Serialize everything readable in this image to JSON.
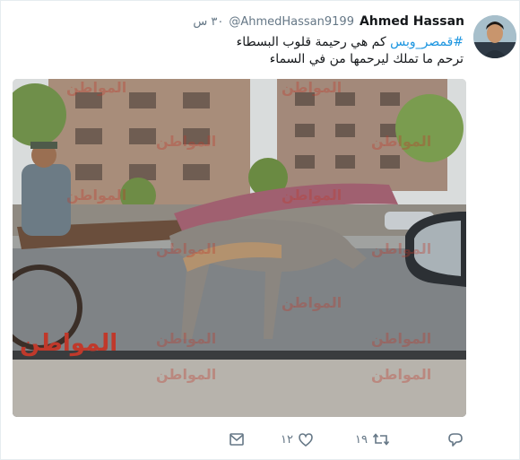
{
  "tweet": {
    "author_name": "Ahmed Hassan",
    "author_handle": "@AhmedHassan9199",
    "timestamp": "٣٠ س",
    "hashtag": "#قمصر_وبس",
    "text_line1": " كم هي رحيمة قلوب البسطاء",
    "text_line2": "ترحم ما تملك ليرحمها من في السماء"
  },
  "photo": {
    "watermark": "المواطن",
    "logo_text": "المواطن"
  },
  "actions": {
    "reply_icon": "reply-icon",
    "retweet_icon": "retweet-icon",
    "retweet_count": "١٩",
    "like_icon": "heart-icon",
    "like_count": "١٢",
    "message_icon": "envelope-icon"
  },
  "colors": {
    "link": "#1b95e0",
    "muted": "#657786",
    "text": "#14171a",
    "watermark": "#c0392b"
  }
}
